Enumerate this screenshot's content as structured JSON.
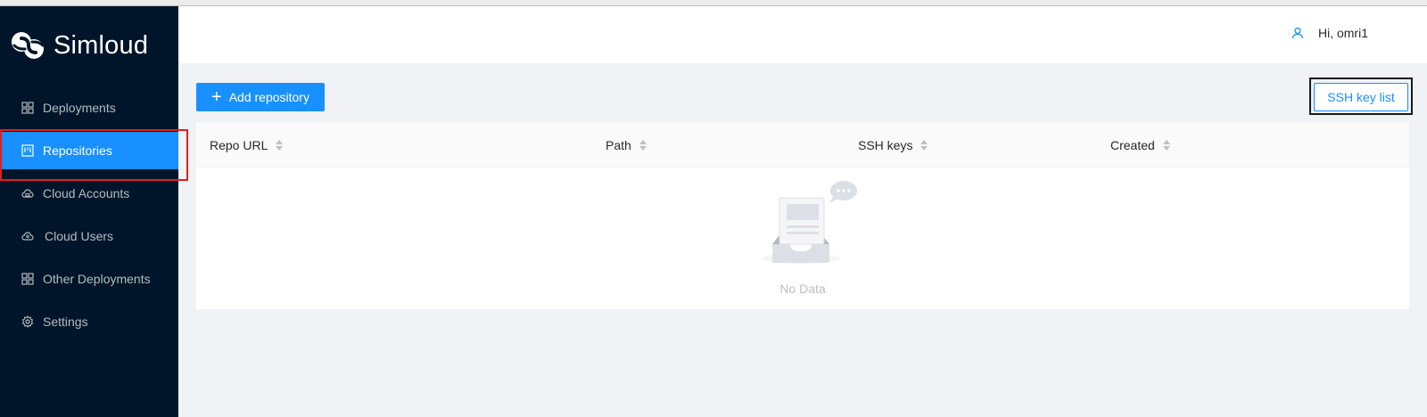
{
  "app": {
    "name": "Simloud"
  },
  "sidebar": {
    "items": [
      {
        "label": "Deployments",
        "icon": "grid-icon",
        "active": false
      },
      {
        "label": "Repositories",
        "icon": "repo-icon",
        "active": true
      },
      {
        "label": "Cloud Accounts",
        "icon": "cloud-icon",
        "active": false
      },
      {
        "label": "Cloud Users",
        "icon": "cloud-user-icon",
        "active": false
      },
      {
        "label": "Other Deployments",
        "icon": "grid-icon",
        "active": false
      },
      {
        "label": "Settings",
        "icon": "gear-icon",
        "active": false
      }
    ]
  },
  "header": {
    "greeting": "Hi, omri1",
    "icon": "user-icon"
  },
  "toolbar": {
    "add_label": "Add repository",
    "ssh_label": "SSH key list"
  },
  "table": {
    "columns": [
      "Repo URL",
      "Path",
      "SSH keys",
      "Created"
    ],
    "rows": [],
    "empty_text": "No Data"
  },
  "colors": {
    "sidebar_bg": "#001529",
    "accent": "#1890ff",
    "page_bg": "#f0f2f5",
    "highlight": "#e02020"
  }
}
